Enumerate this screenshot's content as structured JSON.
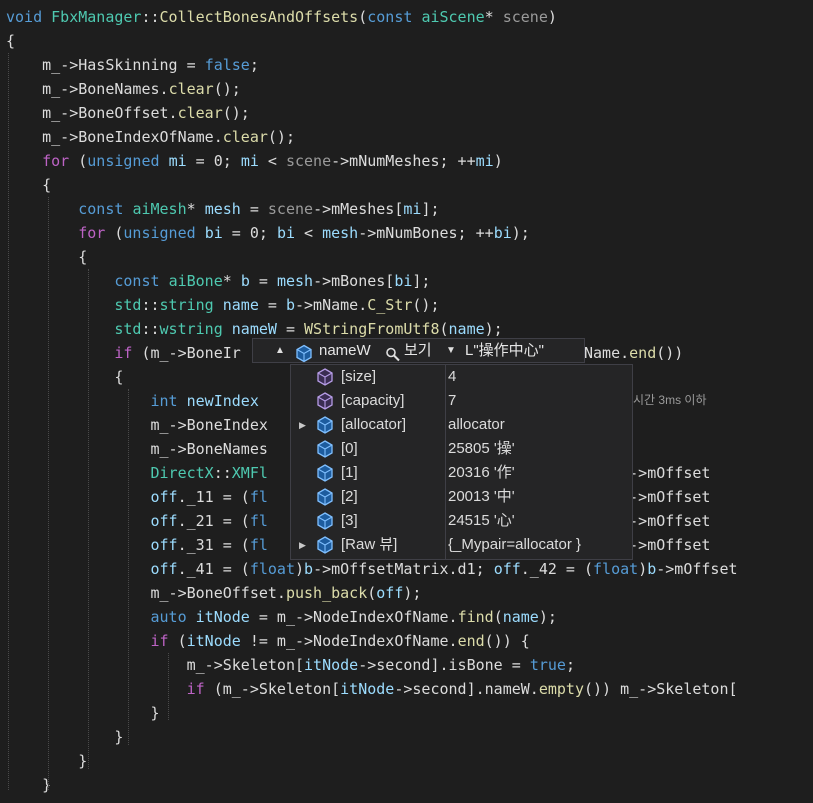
{
  "editor": {
    "lines": [
      [
        {
          "t": "void ",
          "c": "kw"
        },
        {
          "t": "FbxManager",
          "c": "ty"
        },
        {
          "t": "::",
          "c": "op"
        },
        {
          "t": "CollectBonesAndOffsets",
          "c": "fn"
        },
        {
          "t": "(",
          "c": "op"
        },
        {
          "t": "const ",
          "c": "kw"
        },
        {
          "t": "aiScene",
          "c": "ty"
        },
        {
          "t": "* ",
          "c": "op"
        },
        {
          "t": "scene",
          "c": "pm"
        },
        {
          "t": ")",
          "c": "op"
        }
      ],
      [
        {
          "t": "{",
          "c": "op"
        }
      ],
      [
        {
          "t": "    "
        },
        {
          "t": "m_",
          "c": "op"
        },
        {
          "t": "->",
          "c": "op"
        },
        {
          "t": "HasSkinning",
          "c": "op"
        },
        {
          "t": " = ",
          "c": "op"
        },
        {
          "t": "false",
          "c": "kw"
        },
        {
          "t": ";",
          "c": "op"
        }
      ],
      [
        {
          "t": "    "
        },
        {
          "t": "m_->BoneNames.",
          "c": "op"
        },
        {
          "t": "clear",
          "c": "fn"
        },
        {
          "t": "();",
          "c": "op"
        }
      ],
      [
        {
          "t": "    "
        },
        {
          "t": "m_->BoneOffset.",
          "c": "op"
        },
        {
          "t": "clear",
          "c": "fn"
        },
        {
          "t": "();",
          "c": "op"
        }
      ],
      [
        {
          "t": "    "
        },
        {
          "t": "m_->BoneIndexOfName.",
          "c": "op"
        },
        {
          "t": "clear",
          "c": "fn"
        },
        {
          "t": "();",
          "c": "op"
        }
      ],
      [
        {
          "t": "    "
        },
        {
          "t": "for",
          "c": "mc"
        },
        {
          "t": " (",
          "c": "op"
        },
        {
          "t": "unsigned",
          "c": "kw"
        },
        {
          "t": " ",
          "c": "op"
        },
        {
          "t": "mi",
          "c": "id"
        },
        {
          "t": " = 0; ",
          "c": "op"
        },
        {
          "t": "mi",
          "c": "id"
        },
        {
          "t": " < ",
          "c": "op"
        },
        {
          "t": "scene",
          "c": "pm"
        },
        {
          "t": "->mNumMeshes; ++",
          "c": "op"
        },
        {
          "t": "mi",
          "c": "id"
        },
        {
          "t": ")",
          "c": "op"
        }
      ],
      [
        {
          "t": "    "
        },
        {
          "t": "{",
          "c": "op"
        }
      ],
      [
        {
          "t": "        "
        },
        {
          "t": "const ",
          "c": "kw"
        },
        {
          "t": "aiMesh",
          "c": "ty"
        },
        {
          "t": "* ",
          "c": "op"
        },
        {
          "t": "mesh",
          "c": "id"
        },
        {
          "t": " = ",
          "c": "op"
        },
        {
          "t": "scene",
          "c": "pm"
        },
        {
          "t": "->mMeshes[",
          "c": "op"
        },
        {
          "t": "mi",
          "c": "id"
        },
        {
          "t": "];",
          "c": "op"
        }
      ],
      [
        {
          "t": "        "
        },
        {
          "t": "for",
          "c": "mc"
        },
        {
          "t": " (",
          "c": "op"
        },
        {
          "t": "unsigned",
          "c": "kw"
        },
        {
          "t": " ",
          "c": "op"
        },
        {
          "t": "bi",
          "c": "id"
        },
        {
          "t": " = 0; ",
          "c": "op"
        },
        {
          "t": "bi",
          "c": "id"
        },
        {
          "t": " < ",
          "c": "op"
        },
        {
          "t": "mesh",
          "c": "id"
        },
        {
          "t": "->mNumBones; ++",
          "c": "op"
        },
        {
          "t": "bi",
          "c": "id"
        },
        {
          "t": ");",
          "c": "op"
        }
      ],
      [
        {
          "t": "        "
        },
        {
          "t": "{",
          "c": "op"
        }
      ],
      [
        {
          "t": "            "
        },
        {
          "t": "const ",
          "c": "kw"
        },
        {
          "t": "aiBone",
          "c": "ty"
        },
        {
          "t": "* ",
          "c": "op"
        },
        {
          "t": "b",
          "c": "id"
        },
        {
          "t": " = ",
          "c": "op"
        },
        {
          "t": "mesh",
          "c": "id"
        },
        {
          "t": "->mBones[",
          "c": "op"
        },
        {
          "t": "bi",
          "c": "id"
        },
        {
          "t": "];",
          "c": "op"
        }
      ],
      [
        {
          "t": "            "
        },
        {
          "t": "std",
          "c": "ty"
        },
        {
          "t": "::",
          "c": "op"
        },
        {
          "t": "string",
          "c": "ty"
        },
        {
          "t": " ",
          "c": "op"
        },
        {
          "t": "name",
          "c": "id"
        },
        {
          "t": " = ",
          "c": "op"
        },
        {
          "t": "b",
          "c": "id"
        },
        {
          "t": "->mName.",
          "c": "op"
        },
        {
          "t": "C_Str",
          "c": "fn"
        },
        {
          "t": "();",
          "c": "op"
        }
      ],
      [
        {
          "t": "            "
        },
        {
          "t": "std",
          "c": "ty"
        },
        {
          "t": "::",
          "c": "op"
        },
        {
          "t": "wstring",
          "c": "ty"
        },
        {
          "t": " ",
          "c": "op"
        },
        {
          "t": "nameW",
          "c": "id"
        },
        {
          "t": " = ",
          "c": "op"
        },
        {
          "t": "WStringFromUtf8",
          "c": "fn"
        },
        {
          "t": "(",
          "c": "op"
        },
        {
          "t": "name",
          "c": "id"
        },
        {
          "t": ");",
          "c": "op"
        }
      ],
      [
        {
          "t": "            "
        },
        {
          "t": "if",
          "c": "mc"
        },
        {
          "t": " (m_->BoneIr                               IndexOfName.",
          "c": "op"
        },
        {
          "t": "end",
          "c": "fn"
        },
        {
          "t": "())",
          "c": "op"
        }
      ],
      [
        {
          "t": "            "
        },
        {
          "t": "{",
          "c": "op"
        }
      ],
      [
        {
          "t": "                "
        },
        {
          "t": "int",
          "c": "kw"
        },
        {
          "t": " ",
          "c": "op"
        },
        {
          "t": "newIndex",
          "c": "id"
        }
      ],
      [
        {
          "t": "                "
        },
        {
          "t": "m_->BoneIndex",
          "c": "op"
        }
      ],
      [
        {
          "t": "                "
        },
        {
          "t": "m_->BoneNames",
          "c": "op"
        }
      ],
      [
        {
          "t": "                "
        },
        {
          "t": "DirectX",
          "c": "ty"
        },
        {
          "t": "::",
          "c": "op"
        },
        {
          "t": "XMFl",
          "c": "ty"
        },
        {
          "t": "                              = (",
          "c": "op"
        },
        {
          "t": "float",
          "c": "kw"
        },
        {
          "t": ")",
          "c": "op"
        },
        {
          "t": "b",
          "c": "id"
        },
        {
          "t": "->mOffset",
          "c": "op"
        }
      ],
      [
        {
          "t": "                "
        },
        {
          "t": "off",
          "c": "id"
        },
        {
          "t": "._11 = (",
          "c": "op"
        },
        {
          "t": "fl",
          "c": "kw"
        },
        {
          "t": "                              = (",
          "c": "op"
        },
        {
          "t": "float",
          "c": "kw"
        },
        {
          "t": ")",
          "c": "op"
        },
        {
          "t": "b",
          "c": "id"
        },
        {
          "t": "->mOffset",
          "c": "op"
        }
      ],
      [
        {
          "t": "                "
        },
        {
          "t": "off",
          "c": "id"
        },
        {
          "t": "._21 = (",
          "c": "op"
        },
        {
          "t": "fl",
          "c": "kw"
        },
        {
          "t": "                              = (",
          "c": "op"
        },
        {
          "t": "float",
          "c": "kw"
        },
        {
          "t": ")",
          "c": "op"
        },
        {
          "t": "b",
          "c": "id"
        },
        {
          "t": "->mOffset",
          "c": "op"
        }
      ],
      [
        {
          "t": "                "
        },
        {
          "t": "off",
          "c": "id"
        },
        {
          "t": "._31 = (",
          "c": "op"
        },
        {
          "t": "fl",
          "c": "kw"
        },
        {
          "t": "                              = (",
          "c": "op"
        },
        {
          "t": "float",
          "c": "kw"
        },
        {
          "t": ")",
          "c": "op"
        },
        {
          "t": "b",
          "c": "id"
        },
        {
          "t": "->mOffset",
          "c": "op"
        }
      ],
      [
        {
          "t": "                "
        },
        {
          "t": "off",
          "c": "id"
        },
        {
          "t": "._41 = (",
          "c": "op"
        },
        {
          "t": "float",
          "c": "kw"
        },
        {
          "t": ")",
          "c": "op"
        },
        {
          "t": "b",
          "c": "id"
        },
        {
          "t": "->mOffsetMatrix.d1; ",
          "c": "op"
        },
        {
          "t": "off",
          "c": "id"
        },
        {
          "t": "._42 = (",
          "c": "op"
        },
        {
          "t": "float",
          "c": "kw"
        },
        {
          "t": ")",
          "c": "op"
        },
        {
          "t": "b",
          "c": "id"
        },
        {
          "t": "->mOffset",
          "c": "op"
        }
      ],
      [
        {
          "t": "                "
        },
        {
          "t": "m_->BoneOffset.",
          "c": "op"
        },
        {
          "t": "push_back",
          "c": "fn"
        },
        {
          "t": "(",
          "c": "op"
        },
        {
          "t": "off",
          "c": "id"
        },
        {
          "t": ");",
          "c": "op"
        }
      ],
      [
        {
          "t": "                "
        },
        {
          "t": "auto",
          "c": "kw"
        },
        {
          "t": " ",
          "c": "op"
        },
        {
          "t": "itNode",
          "c": "id"
        },
        {
          "t": " = m_->NodeIndexOfName.",
          "c": "op"
        },
        {
          "t": "find",
          "c": "fn"
        },
        {
          "t": "(",
          "c": "op"
        },
        {
          "t": "name",
          "c": "id"
        },
        {
          "t": ");",
          "c": "op"
        }
      ],
      [
        {
          "t": "                "
        },
        {
          "t": "if",
          "c": "mc"
        },
        {
          "t": " (",
          "c": "op"
        },
        {
          "t": "itNode",
          "c": "id"
        },
        {
          "t": " != m_->NodeIndexOfName.",
          "c": "op"
        },
        {
          "t": "end",
          "c": "fn"
        },
        {
          "t": "()) {",
          "c": "op"
        }
      ],
      [
        {
          "t": "                    "
        },
        {
          "t": "m_->Skeleton[",
          "c": "op"
        },
        {
          "t": "itNode",
          "c": "id"
        },
        {
          "t": "->second].isBone = ",
          "c": "op"
        },
        {
          "t": "true",
          "c": "kw"
        },
        {
          "t": ";",
          "c": "op"
        }
      ],
      [
        {
          "t": "                    "
        },
        {
          "t": "if",
          "c": "mc"
        },
        {
          "t": " (m_->Skeleton[",
          "c": "op"
        },
        {
          "t": "itNode",
          "c": "id"
        },
        {
          "t": "->second].nameW.",
          "c": "op"
        },
        {
          "t": "empty",
          "c": "fn"
        },
        {
          "t": "()) m_->Skeleton[",
          "c": "op"
        }
      ],
      [
        {
          "t": "                "
        },
        {
          "t": "}",
          "c": "op"
        }
      ],
      [
        {
          "t": "            "
        },
        {
          "t": "}",
          "c": "op"
        }
      ],
      [
        {
          "t": "        "
        },
        {
          "t": "}",
          "c": "op"
        }
      ],
      [
        {
          "t": "    "
        },
        {
          "t": "}",
          "c": "op"
        }
      ]
    ],
    "partial_suffix": "시간 3ms 이하"
  },
  "datatip": {
    "header": {
      "name": "nameW",
      "visualizer": "보기",
      "value": "L\"操作中心\""
    },
    "rows": [
      {
        "expandable": false,
        "icon": "property-icon",
        "name": "[size]",
        "value": "4"
      },
      {
        "expandable": false,
        "icon": "property-icon",
        "name": "[capacity]",
        "value": "7"
      },
      {
        "expandable": true,
        "icon": "field-icon",
        "name": "[allocator]",
        "value": "allocator"
      },
      {
        "expandable": false,
        "icon": "field-icon",
        "name": "[0]",
        "value": "25805 '操'"
      },
      {
        "expandable": false,
        "icon": "field-icon",
        "name": "[1]",
        "value": "20316 '作'"
      },
      {
        "expandable": false,
        "icon": "field-icon",
        "name": "[2]",
        "value": "20013 '中'"
      },
      {
        "expandable": false,
        "icon": "field-icon",
        "name": "[3]",
        "value": "24515 '心'"
      },
      {
        "expandable": true,
        "icon": "field-icon",
        "name": "[Raw 뷰]",
        "value": "{_Mypair=allocator }"
      }
    ]
  }
}
